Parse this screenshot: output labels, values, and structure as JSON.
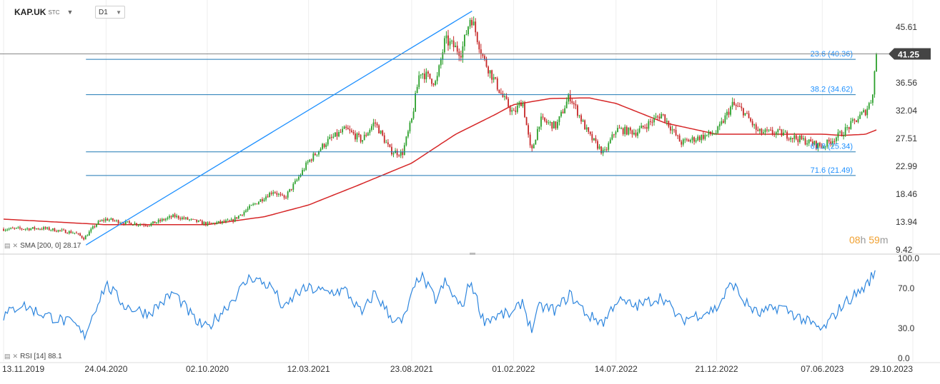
{
  "header": {
    "symbol": "KAP.UK",
    "symbol_suffix": "STC",
    "timeframe": "D1"
  },
  "price_badge": {
    "value": "41.25"
  },
  "countdown": {
    "hours": "08",
    "hours_unit": "h",
    "minutes": "59",
    "minutes_unit": "m"
  },
  "indicators": {
    "sma": {
      "label": "SMA [200, 0]",
      "value": "28.17"
    },
    "rsi": {
      "label": "RSI [14]",
      "value": "88.1"
    }
  },
  "chart_data": [
    {
      "type": "candlestick",
      "title": "KAP.UK",
      "ylim": [
        9.42,
        50.0
      ],
      "y_ticks": [
        "45.61",
        "41.25",
        "36.56",
        "32.04",
        "27.51",
        "22.99",
        "18.46",
        "13.94",
        "9.42"
      ],
      "x_ticks": [
        "13.11.2019",
        "24.04.2020",
        "02.10.2020",
        "12.03.2021",
        "23.08.2021",
        "01.02.2022",
        "14.07.2022",
        "21.12.2022",
        "07.06.2023",
        "29.10.2023"
      ],
      "grid": true,
      "colors": {
        "up": "#2ca02c",
        "down": "#c62828",
        "sma": "#d62728",
        "fib": "#1f78b4",
        "trend": "#1e90ff"
      },
      "last_price": 41.25,
      "price_anchors": [
        [
          "13.11.2019",
          12.8
        ],
        [
          "15.01.2020",
          12.9
        ],
        [
          "05.03.2020",
          12.2
        ],
        [
          "20.03.2020",
          11.3
        ],
        [
          "10.04.2020",
          13.8
        ],
        [
          "24.04.2020",
          14.4
        ],
        [
          "25.05.2020",
          13.8
        ],
        [
          "01.07.2020",
          13.5
        ],
        [
          "10.08.2020",
          14.9
        ],
        [
          "02.10.2020",
          13.6
        ],
        [
          "10.11.2020",
          14.1
        ],
        [
          "10.12.2020",
          16.4
        ],
        [
          "15.01.2021",
          19.0
        ],
        [
          "01.02.2021",
          17.7
        ],
        [
          "20.02.2021",
          20.5
        ],
        [
          "12.03.2021",
          23.8
        ],
        [
          "10.04.2021",
          27.0
        ],
        [
          "10.05.2021",
          29.0
        ],
        [
          "05.06.2021",
          27.2
        ],
        [
          "25.06.2021",
          30.2
        ],
        [
          "20.07.2021",
          25.5
        ],
        [
          "08.08.2021",
          25.0
        ],
        [
          "23.08.2021",
          30.5
        ],
        [
          "05.09.2021",
          38.5
        ],
        [
          "01.10.2021",
          36.5
        ],
        [
          "15.10.2021",
          43.5
        ],
        [
          "10.11.2021",
          41.5
        ],
        [
          "25.11.2021",
          47.5
        ],
        [
          "15.12.2021",
          40.5
        ],
        [
          "15.01.2022",
          34.2
        ],
        [
          "01.02.2022",
          31.5
        ],
        [
          "15.02.2022",
          33.8
        ],
        [
          "01.03.2022",
          25.0
        ],
        [
          "15.03.2022",
          30.5
        ],
        [
          "10.04.2022",
          29.5
        ],
        [
          "01.05.2022",
          34.5
        ],
        [
          "01.06.2022",
          28.0
        ],
        [
          "25.06.2022",
          25.0
        ],
        [
          "14.07.2022",
          29.0
        ],
        [
          "15.08.2022",
          28.5
        ],
        [
          "25.09.2022",
          31.5
        ],
        [
          "25.10.2022",
          26.8
        ],
        [
          "21.12.2022",
          28.5
        ],
        [
          "15.01.2023",
          33.0
        ],
        [
          "01.02.2023",
          32.0
        ],
        [
          "25.02.2023",
          28.5
        ],
        [
          "01.04.2023",
          28.4
        ],
        [
          "07.06.2023",
          26.2
        ],
        [
          "10.07.2023",
          28.5
        ],
        [
          "15.08.2023",
          32.0
        ],
        [
          "25.08.2023",
          34.0
        ],
        [
          "01.09.2023",
          41.25
        ]
      ],
      "sma_200_anchors": [
        [
          "13.11.2019",
          14.4
        ],
        [
          "24.04.2020",
          13.5
        ],
        [
          "02.10.2020",
          13.5
        ],
        [
          "01.01.2021",
          14.8
        ],
        [
          "12.03.2021",
          16.7
        ],
        [
          "01.06.2021",
          20.0
        ],
        [
          "23.08.2021",
          23.5
        ],
        [
          "01.11.2021",
          28.2
        ],
        [
          "01.01.2022",
          31.3
        ],
        [
          "01.02.2022",
          33.0
        ],
        [
          "01.04.2022",
          34.0
        ],
        [
          "01.06.2022",
          34.1
        ],
        [
          "14.07.2022",
          33.2
        ],
        [
          "01.10.2022",
          30.0
        ],
        [
          "21.12.2022",
          28.2
        ],
        [
          "07.06.2023",
          28.2
        ],
        [
          "10.07.2023",
          28.0
        ],
        [
          "15.08.2023",
          28.2
        ],
        [
          "01.09.2023",
          28.9
        ]
      ],
      "fibonacci": [
        {
          "label": "23.6 (40.36)",
          "value": 40.36
        },
        {
          "label": "38.2 (34.62)",
          "value": 34.62
        },
        {
          "label": "61.8 (25.34)",
          "value": 25.34
        },
        {
          "label": "71.6 (21.49)",
          "value": 21.49
        }
      ],
      "trendline": {
        "start": [
          "23.03.2020",
          10.2
        ],
        "end": [
          "27.11.2021",
          48.2
        ]
      }
    },
    {
      "type": "line",
      "title": "RSI [14]",
      "ylim": [
        0,
        100
      ],
      "y_ticks": [
        "100.0",
        "70.0",
        "30.0",
        "0.0"
      ],
      "last_value": 88.1,
      "rsi_anchors": [
        [
          "13.11.2019",
          42
        ],
        [
          "10.12.2019",
          54
        ],
        [
          "15.01.2020",
          44
        ],
        [
          "05.03.2020",
          34
        ],
        [
          "20.03.2020",
          22
        ],
        [
          "10.04.2020",
          55
        ],
        [
          "24.04.2020",
          74
        ],
        [
          "25.05.2020",
          52
        ],
        [
          "01.07.2020",
          45
        ],
        [
          "10.08.2020",
          66
        ],
        [
          "15.09.2020",
          36
        ],
        [
          "02.10.2020",
          30
        ],
        [
          "10.11.2020",
          58
        ],
        [
          "10.12.2020",
          82
        ],
        [
          "15.01.2021",
          70
        ],
        [
          "01.02.2021",
          48
        ],
        [
          "20.02.2021",
          65
        ],
        [
          "12.03.2021",
          70
        ],
        [
          "10.04.2021",
          66
        ],
        [
          "10.05.2021",
          68
        ],
        [
          "05.06.2021",
          44
        ],
        [
          "25.06.2021",
          66
        ],
        [
          "20.07.2021",
          42
        ],
        [
          "08.08.2021",
          35
        ],
        [
          "23.08.2021",
          62
        ],
        [
          "05.09.2021",
          84
        ],
        [
          "01.10.2021",
          58
        ],
        [
          "15.10.2021",
          76
        ],
        [
          "10.11.2021",
          50
        ],
        [
          "25.11.2021",
          78
        ],
        [
          "15.12.2021",
          38
        ],
        [
          "15.01.2022",
          44
        ],
        [
          "01.02.2022",
          44
        ],
        [
          "15.02.2022",
          58
        ],
        [
          "01.03.2022",
          28
        ],
        [
          "15.03.2022",
          52
        ],
        [
          "10.04.2022",
          48
        ],
        [
          "01.05.2022",
          64
        ],
        [
          "01.06.2022",
          42
        ],
        [
          "25.06.2022",
          36
        ],
        [
          "14.07.2022",
          58
        ],
        [
          "15.08.2022",
          52
        ],
        [
          "25.09.2022",
          62
        ],
        [
          "25.10.2022",
          38
        ],
        [
          "21.12.2022",
          50
        ],
        [
          "15.01.2023",
          76
        ],
        [
          "01.02.2023",
          58
        ],
        [
          "25.02.2023",
          44
        ],
        [
          "01.04.2023",
          52
        ],
        [
          "07.06.2023",
          28
        ],
        [
          "10.07.2023",
          54
        ],
        [
          "15.08.2023",
          72
        ],
        [
          "25.08.2023",
          82
        ],
        [
          "01.09.2023",
          88.1
        ]
      ]
    }
  ]
}
